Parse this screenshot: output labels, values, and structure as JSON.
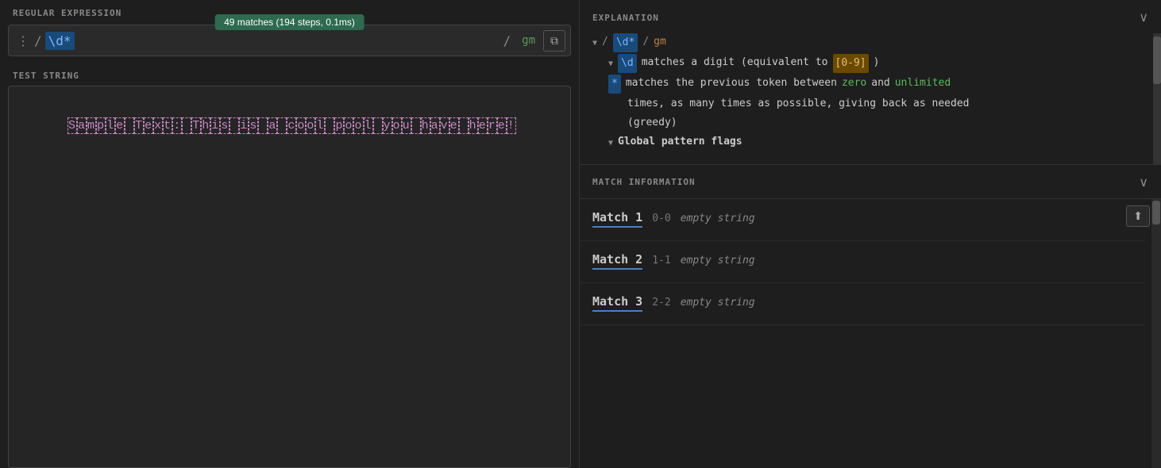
{
  "left": {
    "regex_section_title": "REGULAR EXPRESSION",
    "match_badge": "49 matches (194 steps, 0.1ms)",
    "regex_dots": "⋮",
    "regex_slash_open": "/",
    "regex_value": "\\d*",
    "regex_slash_close": "/",
    "regex_flags": "gm",
    "copy_icon": "⧉",
    "test_string_title": "TEST STRING",
    "test_string": "Sample Text: This is a cool pool you have here!"
  },
  "right": {
    "explanation": {
      "title": "EXPLANATION",
      "chevron": "∨",
      "lines": [
        {
          "type": "main",
          "slash": "/",
          "regex": "\\d*",
          "slash2": "/",
          "flags": "gm"
        },
        {
          "type": "sub1",
          "backslash_d": "\\d",
          "text": " matches a digit (equivalent to ",
          "bracket": "[0-9]",
          "paren": ")"
        },
        {
          "type": "sub2",
          "star": "*",
          "text1": " matches the previous token between ",
          "zero": "zero",
          "and": " and ",
          "unlimited": "unlimited"
        },
        {
          "type": "sub2b",
          "text": "times, as many times as possible, giving back as needed"
        },
        {
          "type": "sub2c",
          "text": "(greedy)"
        },
        {
          "type": "sub3",
          "bold": "Global pattern flags"
        }
      ]
    },
    "match_info": {
      "title": "MATCH INFORMATION",
      "chevron": "∨",
      "export_icon": "⬆",
      "matches": [
        {
          "label": "Match 1",
          "position": "0-0",
          "empty": "empty string"
        },
        {
          "label": "Match 2",
          "position": "1-1",
          "empty": "empty string"
        },
        {
          "label": "Match 3",
          "position": "2-2",
          "empty": "empty string"
        }
      ]
    }
  }
}
